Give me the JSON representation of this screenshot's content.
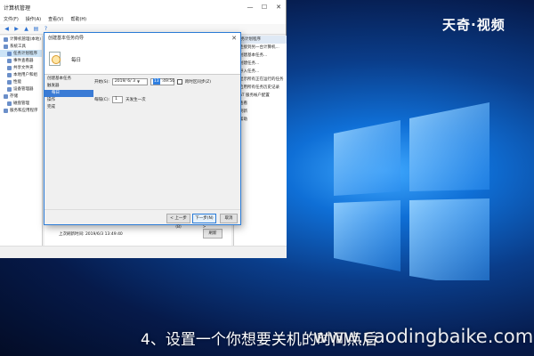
{
  "watermark": "天奇·视频",
  "caption": "4、设置一个你想要关机的时间点后",
  "site_watermark": "www.caodingbaike.com",
  "mmc": {
    "title": "计算机管理",
    "window_controls": [
      "—",
      "☐",
      "✕"
    ],
    "menu": [
      "文件(F)",
      "操作(A)",
      "查看(V)",
      "帮助(H)"
    ],
    "toolbar_icons": [
      "back-icon",
      "forward-icon",
      "up-icon",
      "properties-icon",
      "help-icon"
    ],
    "tree": [
      {
        "label": "计算机管理(本地)",
        "level": 0
      },
      {
        "label": "系统工具",
        "level": 0
      },
      {
        "label": "任务计划程序",
        "level": 1,
        "selected": true
      },
      {
        "label": "事件查看器",
        "level": 1
      },
      {
        "label": "共享文件夹",
        "level": 1
      },
      {
        "label": "本地用户和组",
        "level": 1
      },
      {
        "label": "性能",
        "level": 1
      },
      {
        "label": "设备管理器",
        "level": 1
      },
      {
        "label": "存储",
        "level": 0
      },
      {
        "label": "磁盘管理",
        "level": 1
      },
      {
        "label": "服务和应用程序",
        "level": 0
      }
    ],
    "actions": {
      "header": "任务计划程序",
      "items": [
        "连接到另一台计算机...",
        "创建基本任务...",
        "创建任务...",
        "导入任务...",
        "显示所有正在运行的任务",
        "启用所有任务历史记录",
        "AT 服务帐户配置",
        "查看",
        "刷新",
        "帮助"
      ]
    },
    "last_refresh": "上次刷新时间: 2019/6/3 13:49:40",
    "refresh_button": "刷新"
  },
  "wizard": {
    "title": "创建基本任务向导",
    "heading": "每日",
    "steps": [
      {
        "label": "创建基本任务",
        "sub": false,
        "active": false
      },
      {
        "label": "触发器",
        "sub": false,
        "active": false
      },
      {
        "label": "每日",
        "sub": true,
        "active": true
      },
      {
        "label": "操作",
        "sub": false,
        "active": false
      },
      {
        "label": "完成",
        "sub": false,
        "active": false
      }
    ],
    "start_label": "开始(S):",
    "start_date": "2019/ 6/ 3",
    "start_time_hour": "13",
    "start_time_rest": ":49:56",
    "sync_label": "跨时区同步(Z)",
    "sync_checked": false,
    "recur_label": "每隔(C):",
    "recur_value": "1",
    "recur_suffix": "天发生一次",
    "btn_back": "< 上一步(B)",
    "btn_next": "下一步(N) >",
    "btn_cancel": "取消"
  }
}
